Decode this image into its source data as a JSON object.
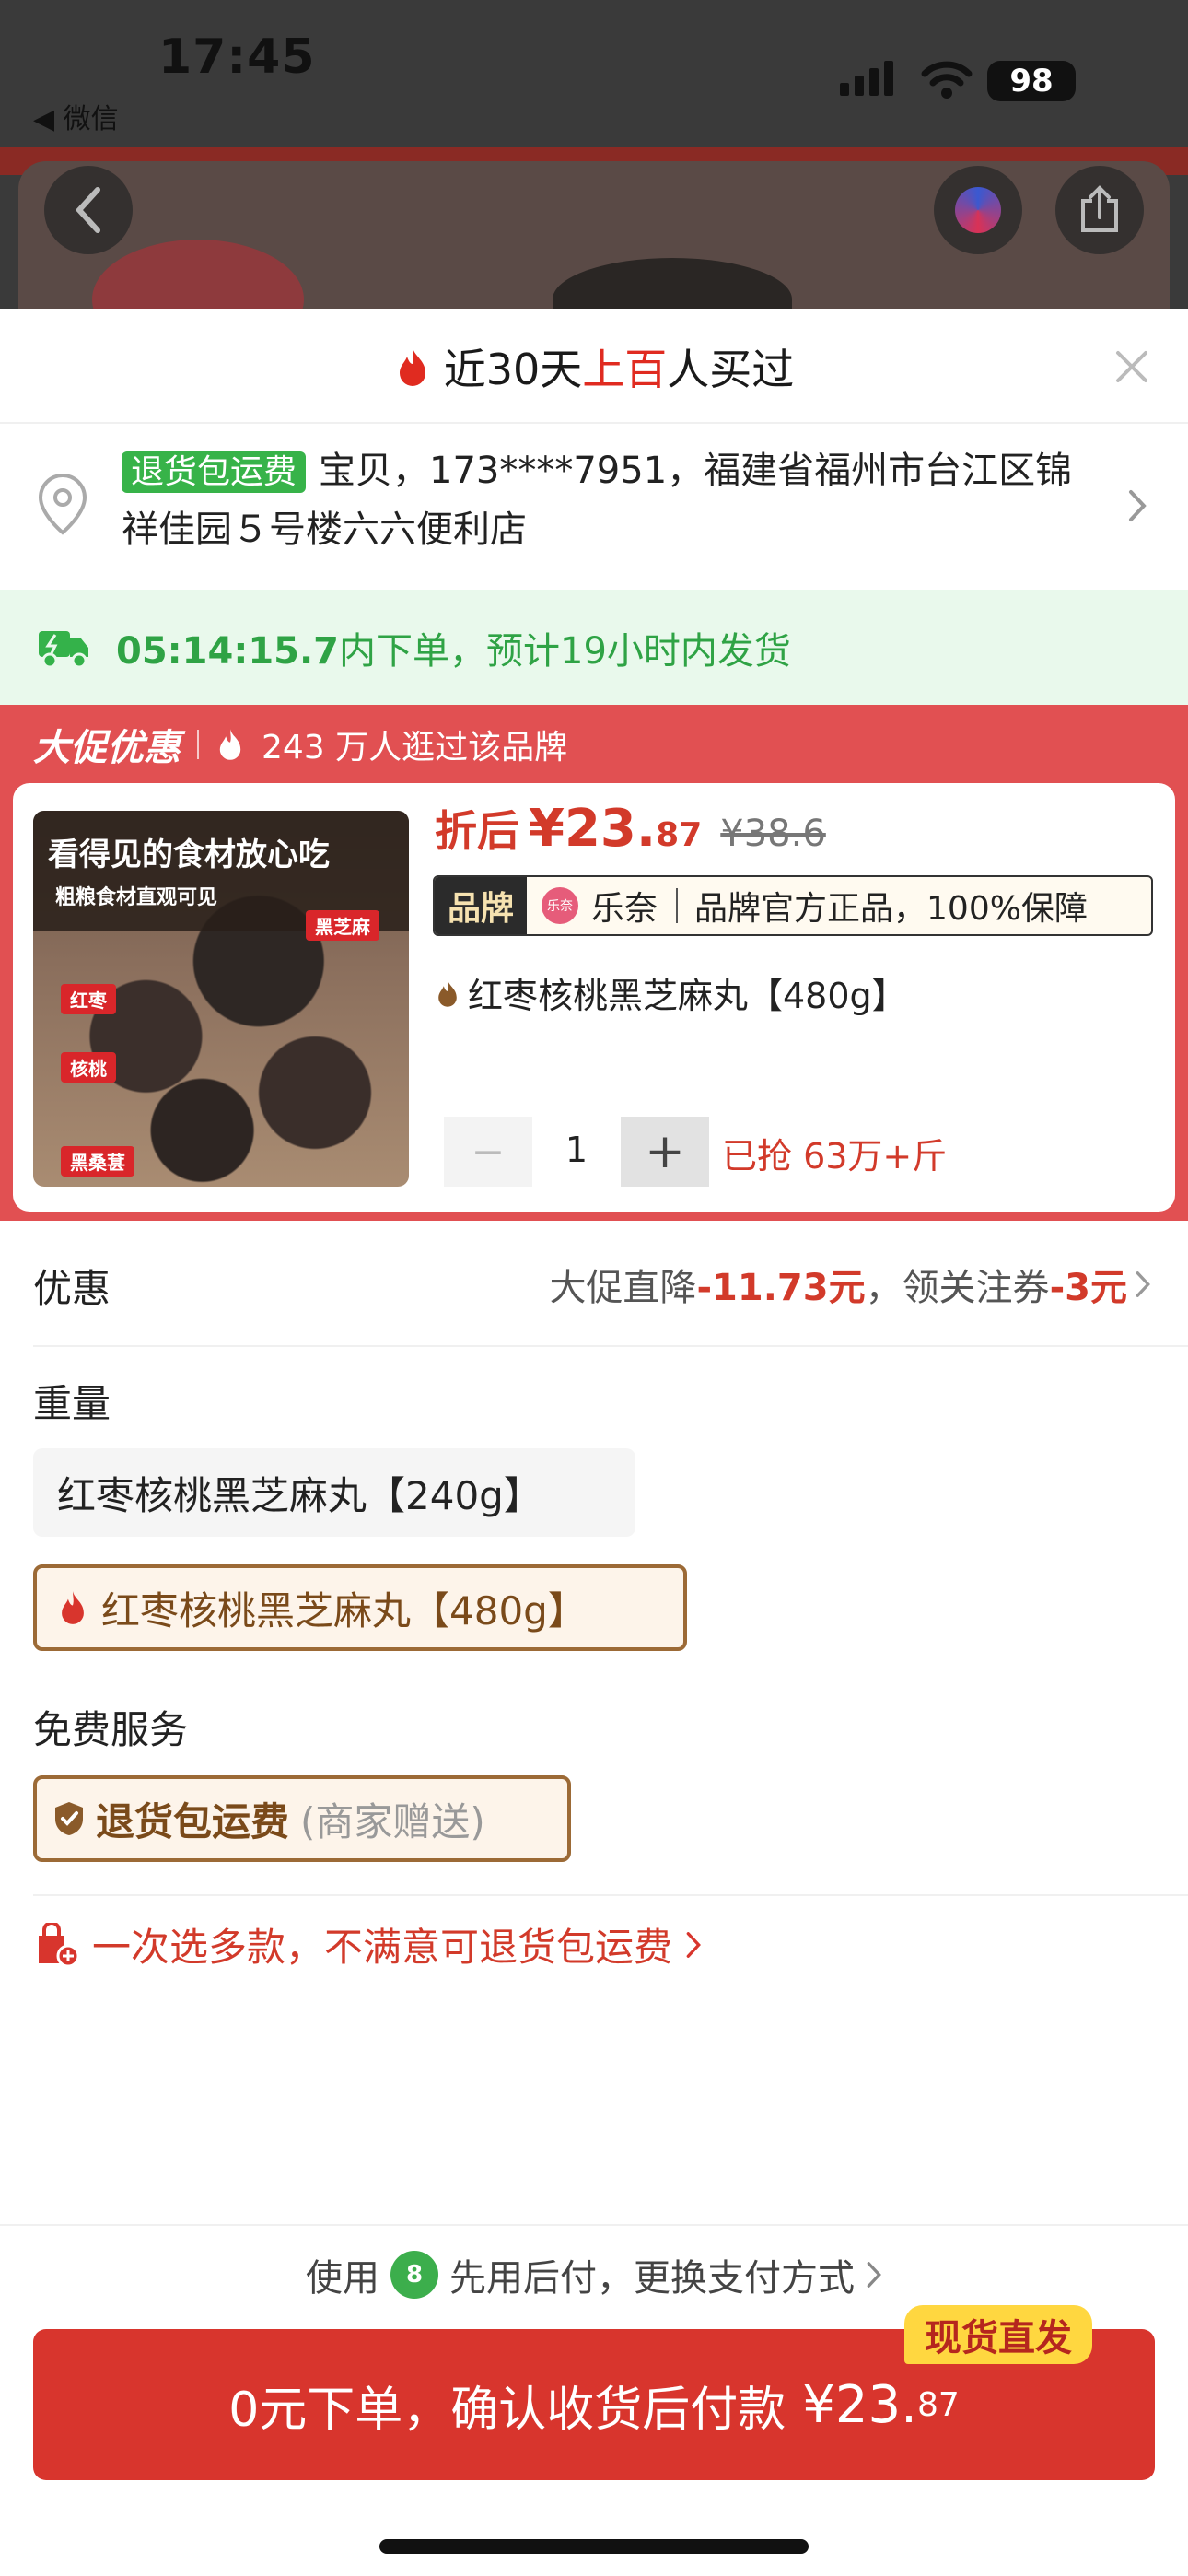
{
  "status_bar": {
    "time": "17:45",
    "back_label": "◀ 微信",
    "battery": "98"
  },
  "sheet_header": {
    "title_prefix": "近30天",
    "title_highlight": "上百",
    "title_suffix": "人买过"
  },
  "address": {
    "tag": "退货包运费",
    "line": "宝贝，173****7951，福建省福州市台江区锦祥佳园５号楼六六便利店"
  },
  "shipping": {
    "countdown": "05:14:15.7",
    "text": "内下单，预计19小时内发货"
  },
  "promo": {
    "logo": "大促优惠",
    "visitors": "243 万人逛过该品牌"
  },
  "product": {
    "image_title": "看得见的食材放心吃",
    "image_subtitle": "粗粮食材直观可见",
    "image_labels": [
      "黑芝麻",
      "红枣",
      "核桃",
      "黑桑葚"
    ],
    "price_prefix": "折后",
    "price_main": "¥23.",
    "price_decimal": "87",
    "original_price": "¥38.6",
    "brand_label": "品牌",
    "brand_logo_text": "乐奈",
    "brand_name": "乐奈",
    "brand_guarantee": "品牌官方正品，100%保障",
    "variant": "红枣核桃黑芝麻丸【480g】",
    "quantity": "1",
    "sold": "已抢 63万+斤"
  },
  "discount": {
    "label": "优惠",
    "promo_text": "大促直降",
    "promo_amount": "-11.73元",
    "sep": "，",
    "coupon_text": "领关注券",
    "coupon_amount": "-3元"
  },
  "weight": {
    "label": "重量",
    "options": [
      "红枣核桃黑芝麻丸【240g】",
      "红枣核桃黑芝麻丸【480g】"
    ],
    "selected_index": 1
  },
  "service": {
    "label": "免费服务",
    "name": "退货包运费",
    "note": "(商家赠送)"
  },
  "multi_select": "一次选多款，不满意可退货包运费",
  "pay_hint": {
    "prefix": "使用",
    "logo_text": "8",
    "text": "先用后付，更换支付方式"
  },
  "cta": {
    "label": "0元下单，确认收货后付款",
    "amount": "¥23.",
    "decimal": "87",
    "badge": "现货直发"
  },
  "colors": {
    "accent_red": "#d8352d",
    "promo_red": "#e15052",
    "green": "#2fa345",
    "brown": "#9c6a36"
  }
}
